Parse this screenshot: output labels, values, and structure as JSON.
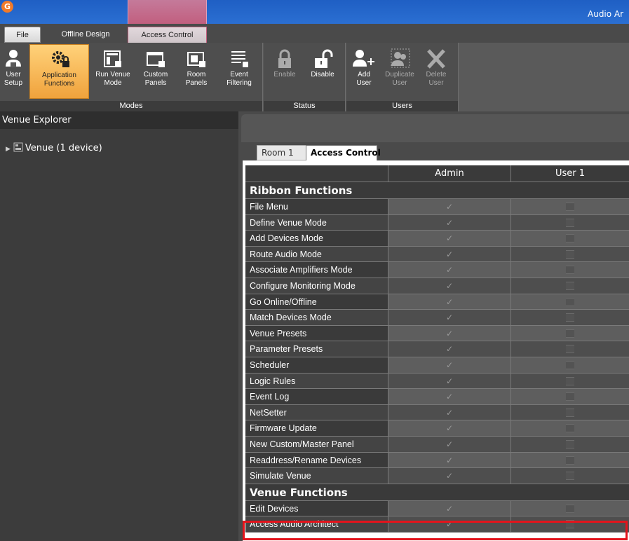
{
  "window": {
    "title": "Audio Ar"
  },
  "tabs": [
    {
      "label": "File"
    },
    {
      "label": "Offline Design"
    },
    {
      "label": "Access Control"
    }
  ],
  "ribbon": {
    "groups": [
      {
        "label": "Modes"
      },
      {
        "label": "Status"
      },
      {
        "label": "Users"
      }
    ],
    "buttons": [
      {
        "label": "User\nSetup",
        "icon": "user-setup-icon",
        "state": "normal"
      },
      {
        "label": "Application\nFunctions",
        "icon": "gear-lock-icon",
        "state": "active"
      },
      {
        "label": "Run Venue\nMode",
        "icon": "run-venue-icon",
        "state": "normal"
      },
      {
        "label": "Custom\nPanels",
        "icon": "custom-panel-icon",
        "state": "normal"
      },
      {
        "label": "Room\nPanels",
        "icon": "room-panel-icon",
        "state": "normal"
      },
      {
        "label": "Event\nFiltering",
        "icon": "event-filter-icon",
        "state": "normal"
      },
      {
        "label": "Enable",
        "icon": "lock-closed-icon",
        "state": "disabled"
      },
      {
        "label": "Disable",
        "icon": "lock-open-icon",
        "state": "normal"
      },
      {
        "label": "Add\nUser",
        "icon": "add-user-icon",
        "state": "normal"
      },
      {
        "label": "Duplicate\nUser",
        "icon": "duplicate-user-icon",
        "state": "disabled"
      },
      {
        "label": "Delete\nUser",
        "icon": "delete-x-icon",
        "state": "disabled"
      }
    ]
  },
  "venue_explorer": {
    "title": "Venue Explorer",
    "tree": [
      {
        "label": "Venue (1 device)",
        "icon": "venue-icon",
        "expanded": false
      }
    ]
  },
  "document_tabs": [
    {
      "label": "Room 1"
    },
    {
      "label": "Access Control"
    }
  ],
  "grid": {
    "columns": [
      "",
      "Admin",
      "User 1"
    ],
    "check_glyph": "✓",
    "sections": [
      {
        "title": "Ribbon Functions",
        "rows": [
          {
            "name": "File Menu",
            "admin": true,
            "user1": false
          },
          {
            "name": "Define Venue Mode",
            "admin": true,
            "user1": false
          },
          {
            "name": "Add Devices Mode",
            "admin": true,
            "user1": false
          },
          {
            "name": "Route Audio Mode",
            "admin": true,
            "user1": false
          },
          {
            "name": "Associate Amplifiers Mode",
            "admin": true,
            "user1": false
          },
          {
            "name": "Configure Monitoring Mode",
            "admin": true,
            "user1": false
          },
          {
            "name": "Go Online/Offline",
            "admin": true,
            "user1": false
          },
          {
            "name": "Match Devices Mode",
            "admin": true,
            "user1": false
          },
          {
            "name": "Venue Presets",
            "admin": true,
            "user1": false
          },
          {
            "name": "Parameter Presets",
            "admin": true,
            "user1": false
          },
          {
            "name": "Scheduler",
            "admin": true,
            "user1": false
          },
          {
            "name": "Logic Rules",
            "admin": true,
            "user1": false
          },
          {
            "name": "Event Log",
            "admin": true,
            "user1": false
          },
          {
            "name": "NetSetter",
            "admin": true,
            "user1": false
          },
          {
            "name": "Firmware Update",
            "admin": true,
            "user1": false
          },
          {
            "name": "New Custom/Master Panel",
            "admin": true,
            "user1": false
          },
          {
            "name": "Readdress/Rename Devices",
            "admin": true,
            "user1": false
          },
          {
            "name": "Simulate Venue",
            "admin": true,
            "user1": false
          }
        ]
      },
      {
        "title": "Venue Functions",
        "rows": [
          {
            "name": "Edit Devices",
            "admin": true,
            "user1": false
          },
          {
            "name": "Access Audio Architect",
            "admin": true,
            "user1": false,
            "highlighted": true
          }
        ]
      }
    ]
  },
  "colors": {
    "highlight": "#e3141c",
    "title_bar": "#2563c8",
    "context_tab": "#c25f7f",
    "active_button": "#f0a23c"
  }
}
